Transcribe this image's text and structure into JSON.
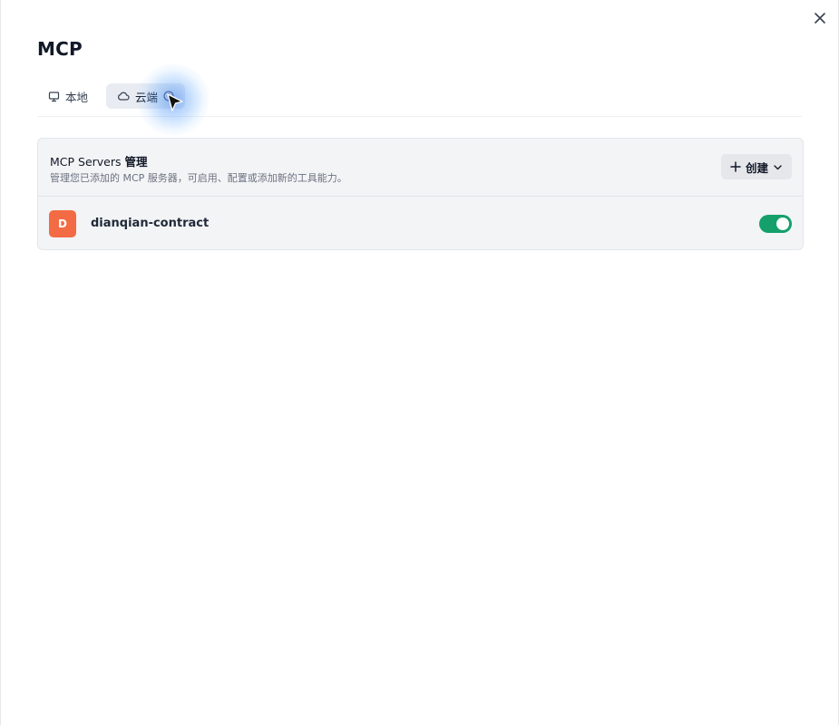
{
  "dialog": {
    "title": "MCP",
    "close_icon": "close-icon"
  },
  "tabs": [
    {
      "label": "本地",
      "icon": "monitor-icon",
      "active": false
    },
    {
      "label": "云端",
      "icon": "cloud-icon",
      "info_icon": "info-icon",
      "active": true
    }
  ],
  "panel": {
    "title_prefix": "MCP Servers ",
    "title_bold": "管理",
    "description": "管理您已添加的 MCP 服务器，可启用、配置或添加新的工具能力。",
    "create_button": {
      "label": "创建",
      "icon": "plus-icon",
      "dropdown_icon": "chevron-down-icon"
    }
  },
  "servers": [
    {
      "initial": "D",
      "name": "dianqian-contract",
      "enabled": true,
      "avatar_color": "#f26b45"
    }
  ],
  "colors": {
    "toggle_on": "#15a06b",
    "panel_bg": "#f3f4f6",
    "active_tab_bg": "#e8ecf2"
  }
}
